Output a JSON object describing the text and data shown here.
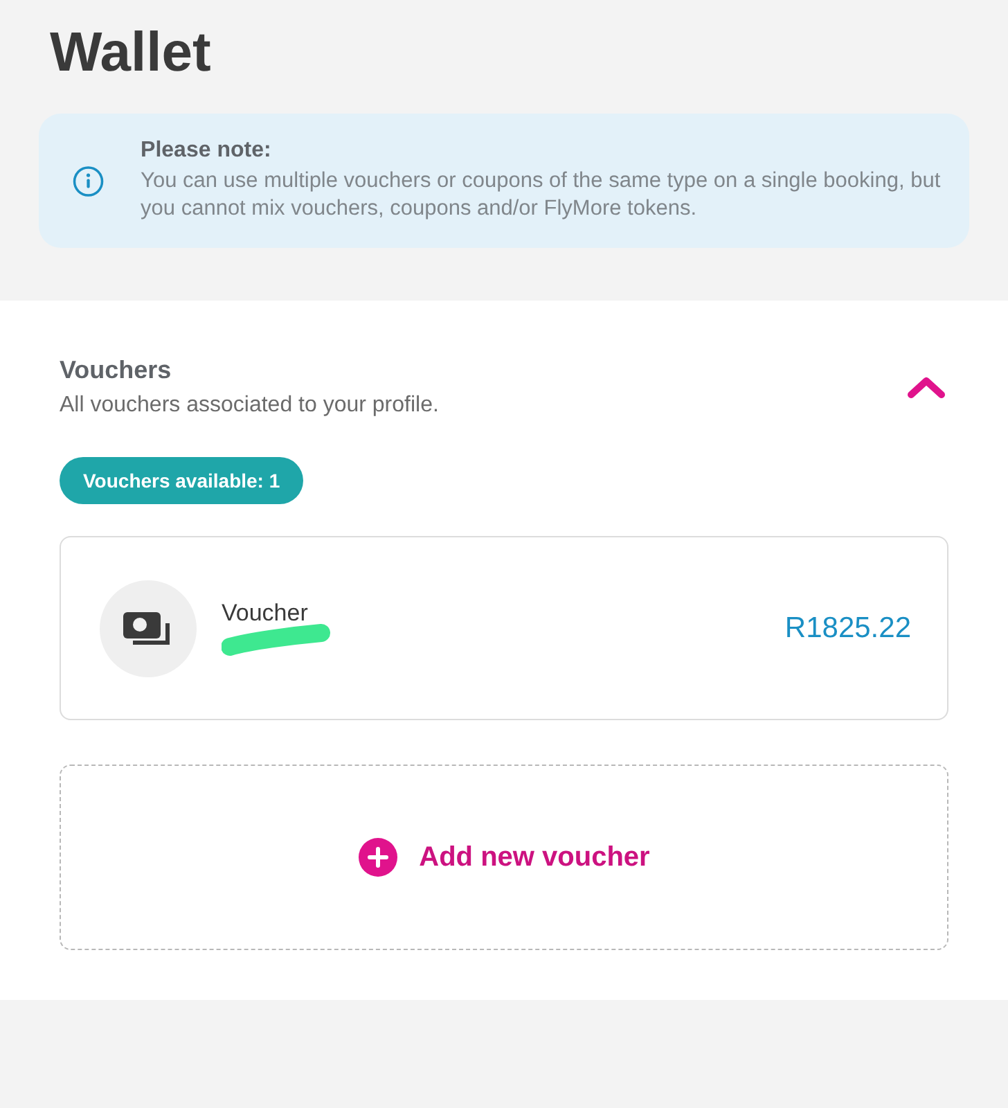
{
  "page": {
    "title": "Wallet"
  },
  "notice": {
    "heading": "Please note:",
    "text": "You can use multiple vouchers or coupons of the same type on a single booking, but you cannot mix vouchers, coupons and/or FlyMore tokens."
  },
  "section": {
    "title": "Vouchers",
    "subtitle": "All vouchers associated to your profile.",
    "expanded": true,
    "badge": "Vouchers available: 1",
    "vouchers": [
      {
        "name": "Voucher",
        "amount": "R1825.22"
      }
    ],
    "add_button": "Add new voucher"
  }
}
